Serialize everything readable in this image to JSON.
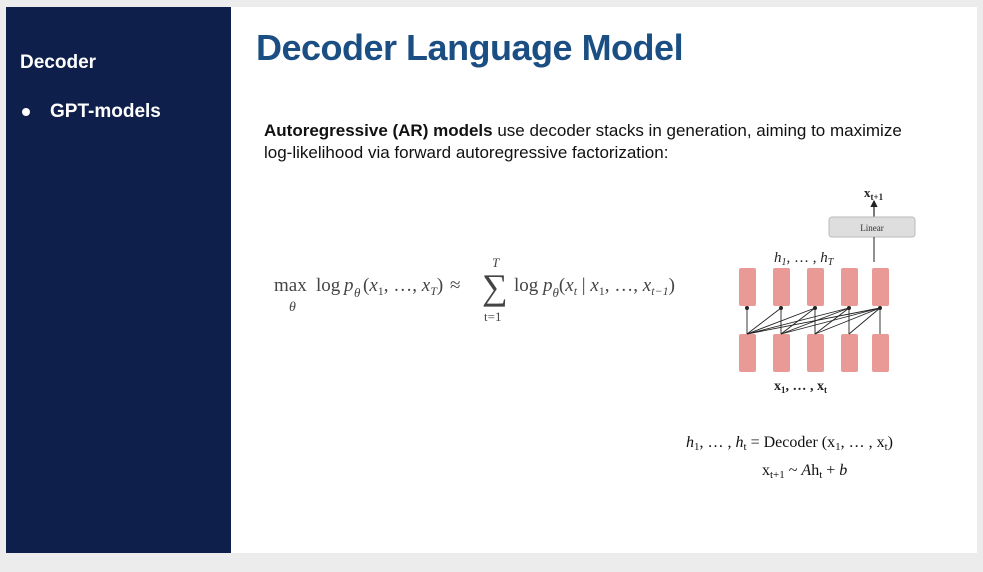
{
  "sidebar": {
    "title": "Decoder",
    "items": [
      {
        "label": "GPT-models"
      }
    ]
  },
  "slide": {
    "title": "Decoder Language Model",
    "description_bold": "Autoregressive (AR) models",
    "description_rest": " use decoder stacks in generation, aiming to maximize log-likelihood via forward autoregressive factorization:"
  },
  "equation": {
    "max": "max",
    "theta": "θ",
    "lhs": "log p",
    "lhs_sub": "θ",
    "lhs_args": "(x",
    "sum_top": "T",
    "sum_bottom": "t=1",
    "sum_symbol": "∑",
    "approx": "≈"
  },
  "diagram": {
    "output_label": "x",
    "output_sub": "t+1",
    "linear_label": "Linear",
    "hidden_label": "h",
    "input_label": "x",
    "colors": {
      "block": "#e99a97",
      "linear": "#dedede"
    }
  },
  "side_equations": {
    "line1_rhs": "Decoder",
    "line2_op": "~"
  }
}
